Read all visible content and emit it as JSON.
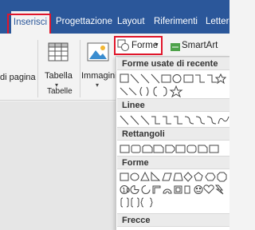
{
  "tabs": [
    {
      "label": "Inserisci",
      "active": true
    },
    {
      "label": "Progettazione"
    },
    {
      "label": "Layout"
    },
    {
      "label": "Riferimenti"
    },
    {
      "label": "Lettere"
    }
  ],
  "ribbon": {
    "page_break_label": "di pagina",
    "table_label": "Tabella",
    "tables_group_label": "Tabelle",
    "images_label": "Immagini",
    "shapes_button_label": "Forme",
    "smartart_label": "SmartArt"
  },
  "shapes_panel": {
    "sections": [
      {
        "title": "Forme usate di recente"
      },
      {
        "title": "Linee"
      },
      {
        "title": "Rettangoli"
      },
      {
        "title": "Forme"
      },
      {
        "title": "Frecce"
      }
    ]
  },
  "colors": {
    "ribbon_accent": "#2b579a",
    "highlight": "#e0162b"
  }
}
